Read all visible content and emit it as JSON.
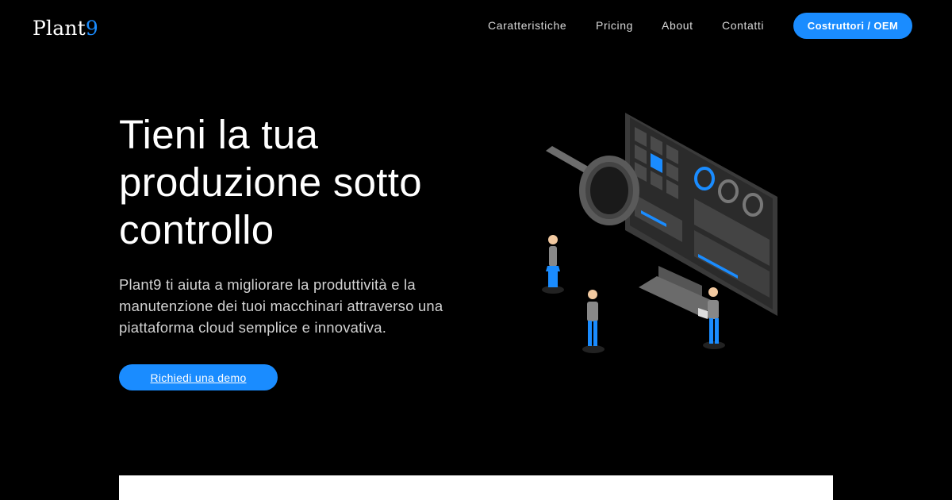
{
  "header": {
    "logo_text": "Plant",
    "logo_accent": "9",
    "nav": [
      {
        "label": "Caratteristiche"
      },
      {
        "label": "Pricing"
      },
      {
        "label": "About"
      },
      {
        "label": "Contatti"
      }
    ],
    "cta_label": "Costruttori / OEM"
  },
  "hero": {
    "title_line1": "Tieni la tua",
    "title_line2": "produzione sotto",
    "title_line3": "controllo",
    "subtitle": "Plant9 ti aiuta a migliorare la produttività e la manutenzione dei tuoi macchinari attraverso una piattaforma cloud semplice e innovativa.",
    "button_label": "Richiedi una demo"
  },
  "colors": {
    "accent": "#1a8cff",
    "background": "#000000"
  }
}
